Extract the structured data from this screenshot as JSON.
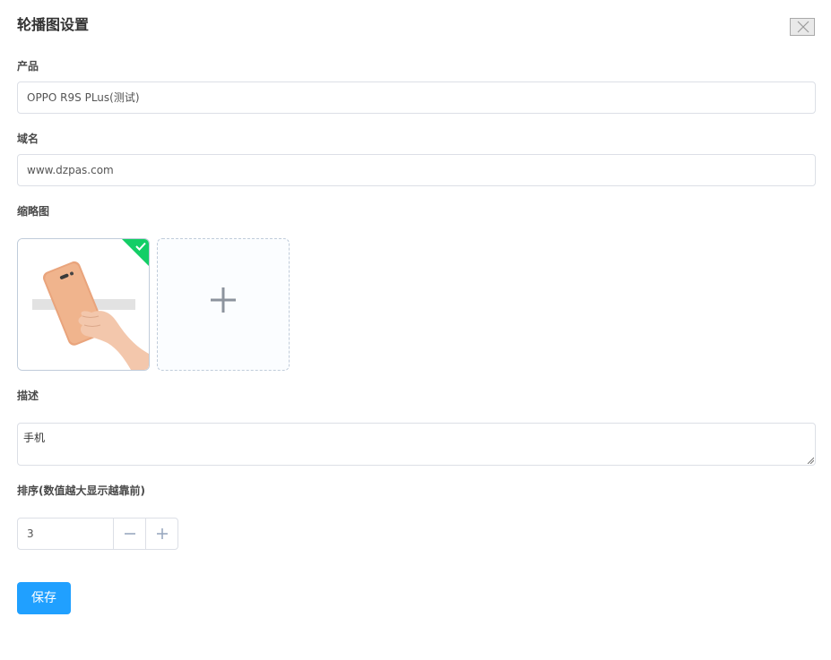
{
  "dialog": {
    "title": "轮播图设置"
  },
  "form": {
    "product": {
      "label": "产品",
      "value": "OPPO R9S PLus(测试)"
    },
    "domain": {
      "label": "域名",
      "value": "www.dzpas.com"
    },
    "thumbnail": {
      "label": "缩略图"
    },
    "description": {
      "label": "描述",
      "value": "手机"
    },
    "order": {
      "label": "排序(数值越大显示越靠前)",
      "value": "3"
    }
  },
  "actions": {
    "save_label": "保存"
  },
  "icons": {
    "close": "close-icon",
    "check": "check-icon",
    "plus": "plus-icon",
    "minus": "minus-icon"
  },
  "colors": {
    "primary": "#20a0ff",
    "success": "#13ce66",
    "border": "#dcdfe6"
  }
}
